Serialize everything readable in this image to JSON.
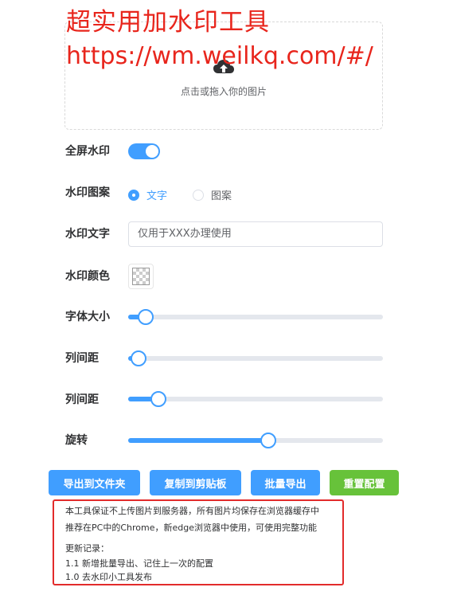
{
  "overlay": {
    "title": "超实用加水印工具",
    "url": "https://wm.weilkq.com/#/"
  },
  "upload": {
    "icon": "cloud-upload-icon",
    "text": "点击或拖入你的图片"
  },
  "settings": {
    "fullscreen": {
      "label": "全屏水印",
      "enabled": true
    },
    "pattern": {
      "label": "水印图案",
      "options": [
        {
          "label": "文字",
          "checked": true
        },
        {
          "label": "图案",
          "checked": false
        }
      ]
    },
    "text": {
      "label": "水印文字",
      "placeholder": "仅用于XXX办理使用"
    },
    "color": {
      "label": "水印颜色"
    },
    "font_size": {
      "label": "字体大小",
      "level": 0.07
    },
    "col_spacing_1": {
      "label": "列间距",
      "level": 0.04
    },
    "col_spacing_2": {
      "label": "列间距",
      "level": 0.12
    },
    "rotate": {
      "label": "旋转",
      "level": 0.55
    }
  },
  "actions": {
    "export_folder": "导出到文件夹",
    "copy_clipboard": "复制到剪贴板",
    "batch_export": "批量导出",
    "reset": "重置配置"
  },
  "notice": {
    "line1": "本工具保证不上传图片到服务器，所有图片均保存在浏览器缓存中",
    "line2": "推荐在PC中的Chrome，新edge浏览器中使用，可使用完整功能",
    "changelog_title": "更新记录：",
    "changelog_1": "1.1 新增批量导出、记住上一次的配置",
    "changelog_2": "1.0 去水印小工具发布"
  },
  "colors": {
    "primary": "#409eff",
    "success": "#67c23a",
    "annotation_red": "#e8251c"
  }
}
